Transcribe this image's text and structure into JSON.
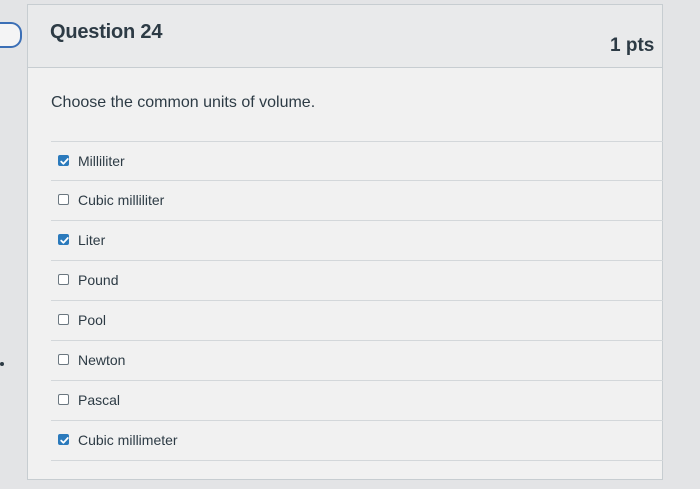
{
  "question": {
    "title": "Question 24",
    "points": "1 pts",
    "prompt": "Choose the common units of volume."
  },
  "answers": [
    {
      "label": "Milliliter",
      "checked": true
    },
    {
      "label": "Cubic milliliter",
      "checked": false
    },
    {
      "label": "Liter",
      "checked": true
    },
    {
      "label": "Pound",
      "checked": false
    },
    {
      "label": "Pool",
      "checked": false
    },
    {
      "label": "Newton",
      "checked": false
    },
    {
      "label": "Pascal",
      "checked": false
    },
    {
      "label": "Cubic millimeter",
      "checked": true
    }
  ],
  "colors": {
    "checkbox_checked": "#2b7abc",
    "text": "#2d3b45"
  }
}
